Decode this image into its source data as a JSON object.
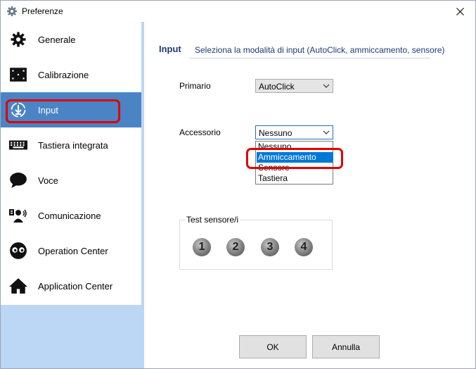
{
  "window": {
    "title": "Preferenze"
  },
  "sidebar": {
    "items": [
      {
        "label": "Generale",
        "icon": "gear-icon"
      },
      {
        "label": "Calibrazione",
        "icon": "calibration-icon"
      },
      {
        "label": "Input",
        "icon": "input-icon"
      },
      {
        "label": "Tastiera integrata",
        "icon": "keyboard-icon"
      },
      {
        "label": "Voce",
        "icon": "speech-bubble-icon"
      },
      {
        "label": "Comunicazione",
        "icon": "communication-icon"
      },
      {
        "label": "Operation Center",
        "icon": "eyes-icon"
      },
      {
        "label": "Application Center",
        "icon": "home-icon"
      }
    ],
    "active_index": 2
  },
  "section": {
    "title": "Input",
    "description": "Seleziona la modalità di input (AutoClick, ammiccamento, sensore)"
  },
  "form": {
    "primary_label": "Primario",
    "primary_value": "AutoClick",
    "accessory_label": "Accessorio",
    "accessory_value": "Nessuno",
    "accessory_options": [
      "Nessuno",
      "Ammiccamento",
      "Sensore",
      "Tastiera"
    ],
    "accessory_highlighted_option": "Ammiccamento"
  },
  "sensor_test": {
    "title": "Test sensore/i",
    "sensors": [
      "1",
      "2",
      "3",
      "4"
    ]
  },
  "buttons": {
    "ok": "OK",
    "cancel": "Annulla"
  },
  "colors": {
    "active_item": "#4a84c5",
    "sidebar_bg": "#bcd6f5",
    "annotation": "#e00000",
    "selection": "#0078d7"
  }
}
